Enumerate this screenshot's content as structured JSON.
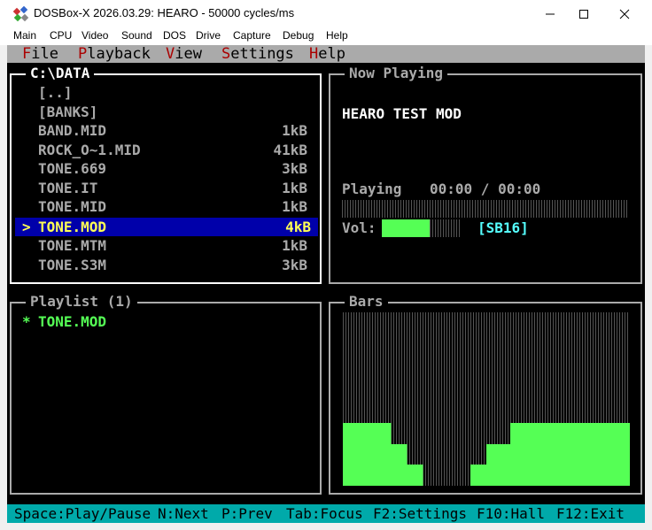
{
  "window": {
    "title": "DOSBox-X 2026.03.29: HEARO - 50000 cycles/ms",
    "controls": [
      "minimize-icon",
      "maximize-icon",
      "close-icon"
    ]
  },
  "host_menu": [
    "Main",
    "CPU",
    "Video",
    "Sound",
    "DOS",
    "Drive",
    "Capture",
    "Debug",
    "Help"
  ],
  "app_menu": [
    {
      "hot": "F",
      "rest": "ile"
    },
    {
      "hot": "P",
      "rest": "layback"
    },
    {
      "hot": "V",
      "rest": "iew"
    },
    {
      "hot": "S",
      "rest": "ettings"
    },
    {
      "hot": "H",
      "rest": "elp"
    }
  ],
  "file_browser": {
    "path": "C:\\DATA",
    "items": [
      {
        "name": "[..]",
        "size": ""
      },
      {
        "name": "[BANKS]",
        "size": ""
      },
      {
        "name": "BAND.MID",
        "size": "1kB"
      },
      {
        "name": "ROCK_O~1.MID",
        "size": "41kB"
      },
      {
        "name": "TONE.669",
        "size": "3kB"
      },
      {
        "name": "TONE.IT",
        "size": "1kB"
      },
      {
        "name": "TONE.MID",
        "size": "1kB"
      },
      {
        "name": "TONE.MOD",
        "size": "4kB",
        "selected": true
      },
      {
        "name": "TONE.MTM",
        "size": "1kB"
      },
      {
        "name": "TONE.S3M",
        "size": "3kB"
      }
    ],
    "cursor": ">"
  },
  "now_playing": {
    "title": "Now Playing",
    "song": "HEARO TEST MOD",
    "status": "Playing",
    "time": "00:00 / 00:00",
    "progress": 0,
    "volume_label": "Vol:",
    "volume": 0.6,
    "device": "[SB16]"
  },
  "playlist": {
    "title": "Playlist (1)",
    "entries": [
      {
        "marker": "*",
        "name": "TONE.MOD"
      }
    ]
  },
  "bars": {
    "title": "Bars",
    "levels": [
      4,
      4,
      4,
      4,
      4,
      4,
      4,
      4,
      4,
      4,
      4,
      4,
      4,
      4,
      4,
      4,
      4,
      4,
      4,
      4,
      4,
      4,
      4,
      4,
      4,
      4,
      4,
      4,
      4,
      4,
      4,
      4,
      4,
      4,
      4,
      4,
      4,
      4,
      4,
      4,
      4,
      4,
      4,
      4,
      4,
      4,
      4,
      4,
      4,
      4,
      4,
      4,
      4,
      4,
      4,
      4,
      4,
      4,
      4,
      4,
      4,
      4,
      4,
      4,
      4,
      4,
      4,
      4,
      4,
      4,
      4,
      4,
      4,
      4,
      4,
      4,
      4,
      4,
      4,
      4,
      4,
      4,
      4,
      4,
      4,
      4,
      4,
      4,
      4,
      4,
      4,
      4,
      4,
      4,
      4,
      4,
      4,
      4,
      4,
      4,
      4,
      4,
      4,
      4,
      4,
      4,
      4,
      4,
      4,
      4,
      4,
      4,
      4,
      4,
      4,
      4,
      4,
      4,
      4,
      4,
      4,
      4,
      4,
      4,
      4,
      4,
      4,
      4,
      4,
      4,
      4,
      4,
      4,
      4,
      4,
      4,
      4,
      4,
      4,
      4,
      4,
      4,
      4,
      4,
      4,
      4,
      4,
      4,
      4,
      4,
      4,
      4,
      4,
      4,
      4,
      4,
      4,
      4,
      4,
      4,
      4,
      4,
      4,
      4,
      4,
      4,
      4,
      4,
      4,
      4,
      4,
      4,
      4,
      4,
      4,
      4,
      4,
      4,
      4,
      4,
      4,
      4,
      4,
      4,
      4,
      4,
      4,
      4,
      4,
      4,
      4,
      4,
      4,
      4,
      4,
      4,
      4,
      4,
      4,
      4,
      4,
      4,
      4,
      4,
      4,
      4,
      4,
      4,
      4,
      4,
      4,
      4,
      4,
      4,
      4,
      4,
      4,
      4,
      4,
      4,
      4,
      4,
      4,
      4,
      4,
      4,
      4,
      4,
      4,
      4,
      4,
      4,
      4,
      4,
      4,
      4,
      4,
      4,
      4,
      4,
      4,
      4,
      4,
      4,
      4,
      4,
      4,
      4,
      4,
      4,
      4,
      4,
      4,
      4,
      4,
      4,
      4,
      4,
      4,
      4,
      4,
      4,
      4,
      4,
      4,
      4,
      4,
      4,
      4,
      4,
      4,
      4,
      4,
      4,
      4,
      4,
      4,
      4,
      4,
      4,
      4,
      4,
      4,
      4,
      4,
      4,
      4,
      4,
      4,
      4,
      4,
      4,
      4,
      4,
      4,
      4,
      4,
      4,
      4,
      4,
      4,
      4,
      4,
      4,
      4,
      4,
      4,
      4,
      4,
      4,
      4,
      4,
      4,
      4,
      4,
      4,
      4,
      4,
      4,
      4,
      4,
      4,
      4,
      4,
      4,
      4,
      4,
      4,
      4,
      4,
      4,
      4,
      4,
      4,
      4,
      4,
      4,
      4,
      4,
      4,
      4,
      4,
      4,
      4,
      4,
      4,
      4,
      4,
      4,
      4,
      4,
      4,
      4,
      4,
      4,
      4,
      4,
      4,
      4,
      4,
      4
    ],
    "columns": [
      0.36,
      0.36,
      0.36,
      0.36,
      0.36,
      0.36,
      0.24,
      0.24,
      0.12,
      0.12,
      0,
      0,
      0,
      0,
      0,
      0,
      0.12,
      0.12,
      0.24,
      0.24,
      0.24,
      0.36,
      0.36,
      0.36,
      0.36,
      0.36,
      0.36,
      0.36,
      0.36,
      0.36,
      0.36,
      0.36,
      0.36,
      0.36,
      0.36,
      0.36
    ]
  },
  "status_bar": [
    "Space:Play/Pause",
    "N:Next",
    "P:Prev",
    "Tab:Focus",
    "F2:Settings",
    "F10:Hall",
    "F12:Exit"
  ],
  "colors": {
    "green": "#55ff55",
    "cyan": "#55ffff",
    "selection_bg": "#0000aa",
    "selection_fg": "#ffff55",
    "status_bg": "#00aaaa"
  }
}
